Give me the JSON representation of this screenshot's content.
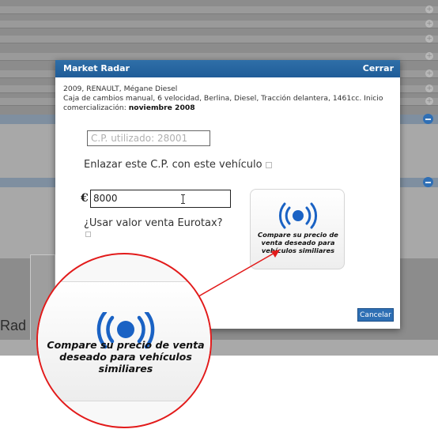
{
  "modal": {
    "title": "Market Radar",
    "close_label": "Cerrar",
    "vehicle_line1": "2009, RENAULT, Mégane Diesel",
    "vehicle_line2": "Caja de cambios manual, 6 velocidad, Berlina, Diesel, Tracción delantera, 1461cc. Inicio comercialización:",
    "vehicle_date": "noviembre 2008",
    "cp_placeholder": "C.P. utilizado: 28001",
    "link_cp_label": "Enlazar este C.P. con este vehículo",
    "price_currency": "€",
    "price_value": "8000",
    "eurotax_label": "¿Usar valor venta Eurotax?",
    "compare_button_text": "Compare su precio de venta deseado para vehículos similiares",
    "compare_icon": "radar-signal-icon",
    "cancel_label": "Cancelar"
  },
  "background": {
    "radar_text": "Rad"
  },
  "colors": {
    "header_blue": "#1f5c98",
    "icon_blue": "#1a62c4",
    "callout_red": "#e21a1a",
    "overlay_grey": "#8c8c8c"
  }
}
